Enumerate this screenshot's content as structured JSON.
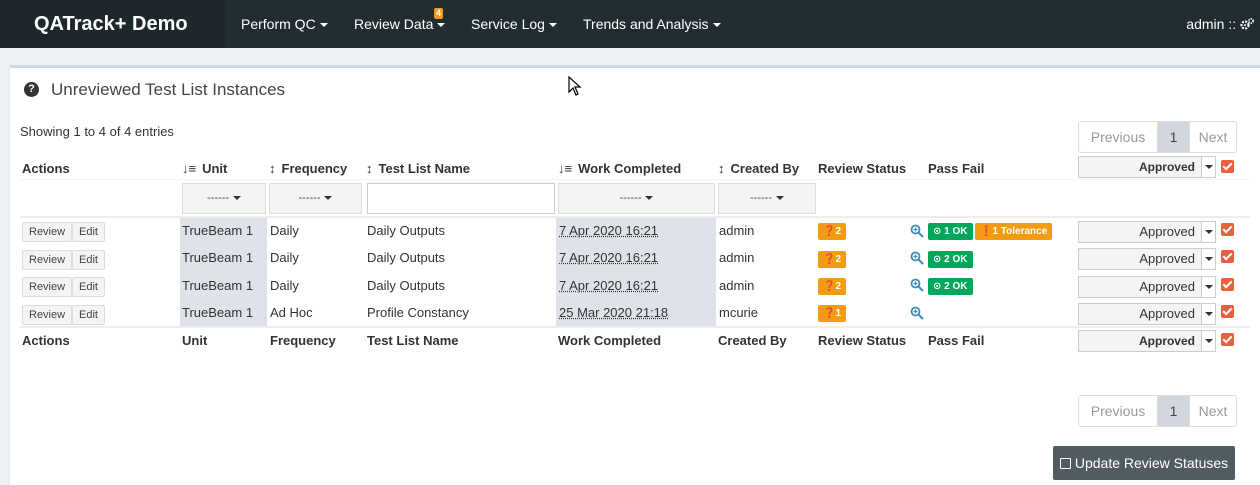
{
  "navbar": {
    "brand": "QATrack+ Demo",
    "items": [
      {
        "label": "Perform QC"
      },
      {
        "label": "Review Data",
        "badge": "4"
      },
      {
        "label": "Service Log"
      },
      {
        "label": "Trends and Analysis"
      }
    ],
    "user": "admin ::"
  },
  "box": {
    "title": "Unreviewed Test List Instances",
    "info": "Showing 1 to 4 of 4 entries"
  },
  "pager": {
    "prev": "Previous",
    "page": "1",
    "next": "Next"
  },
  "columns": {
    "actions": "Actions",
    "unit": "Unit",
    "frequency": "Frequency",
    "test_list_name": "Test List Name",
    "work_completed": "Work Completed",
    "created_by": "Created By",
    "review_status": "Review Status",
    "pass_fail": "Pass Fail"
  },
  "filters": {
    "dash": "------"
  },
  "bulk_status": "Approved",
  "rows": [
    {
      "review": "Review",
      "edit": "Edit",
      "unit": "TrueBeam 1",
      "frequency": "Daily",
      "test_list": "Daily Outputs",
      "work_completed": "7 Apr 2020 16:21",
      "created_by": "admin",
      "review_badge": "2",
      "pass_fail": [
        "1 OK",
        "1 Tolerance"
      ],
      "status": "Approved"
    },
    {
      "review": "Review",
      "edit": "Edit",
      "unit": "TrueBeam 1",
      "frequency": "Daily",
      "test_list": "Daily Outputs",
      "work_completed": "7 Apr 2020 16:21",
      "created_by": "admin",
      "review_badge": "2",
      "pass_fail": [
        "2 OK"
      ],
      "status": "Approved"
    },
    {
      "review": "Review",
      "edit": "Edit",
      "unit": "TrueBeam 1",
      "frequency": "Daily",
      "test_list": "Daily Outputs",
      "work_completed": "7 Apr 2020 16:21",
      "created_by": "admin",
      "review_badge": "2",
      "pass_fail": [
        "2 OK"
      ],
      "status": "Approved"
    },
    {
      "review": "Review",
      "edit": "Edit",
      "unit": "TrueBeam 1",
      "frequency": "Ad Hoc",
      "test_list": "Profile Constancy",
      "work_completed": "25 Mar 2020 21:18",
      "created_by": "mcurie",
      "review_badge": "1",
      "pass_fail": [],
      "status": "Approved"
    }
  ],
  "update_button": "Update Review Statuses",
  "colors": {
    "nav_bg": "#222d32",
    "brand_bg": "#1e282c",
    "ok": "#00a65a",
    "warning": "#f39c12",
    "checkbox": "#e8603c"
  }
}
